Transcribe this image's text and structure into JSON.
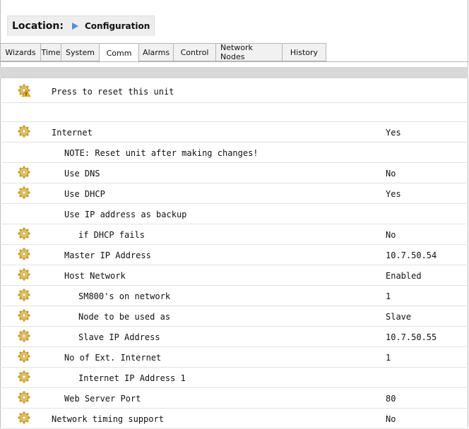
{
  "location": {
    "label": "Location:",
    "value": "Configuration"
  },
  "tabs": [
    {
      "label": "Wizards",
      "active": false
    },
    {
      "label": "Time",
      "active": false
    },
    {
      "label": "System",
      "active": false
    },
    {
      "label": "Comm",
      "active": true
    },
    {
      "label": "Alarms",
      "active": false
    },
    {
      "label": "Control",
      "active": false
    },
    {
      "label": "Network Nodes",
      "active": false
    },
    {
      "label": "History",
      "active": false
    }
  ],
  "rows": [
    {
      "icon": "warning-gear-icon",
      "label": "Press to reset this unit",
      "value": "",
      "indent": 0
    },
    {
      "icon": "",
      "label": "",
      "value": "",
      "indent": 0,
      "blank": true
    },
    {
      "icon": "gear-icon",
      "label": "Internet",
      "value": "Yes",
      "indent": 0
    },
    {
      "icon": "",
      "label": "NOTE: Reset unit after making changes!",
      "value": "",
      "indent": 1
    },
    {
      "icon": "gear-icon",
      "label": "Use DNS",
      "value": "No",
      "indent": 1
    },
    {
      "icon": "gear-icon",
      "label": "Use DHCP",
      "value": "Yes",
      "indent": 1
    },
    {
      "icon": "",
      "label": "Use IP address as backup",
      "value": "",
      "indent": 1
    },
    {
      "icon": "gear-icon",
      "label": "if DHCP fails",
      "value": "No",
      "indent": 2
    },
    {
      "icon": "gear-icon",
      "label": "Master IP Address",
      "value": "10.7.50.54",
      "indent": 1
    },
    {
      "icon": "gear-icon",
      "label": "Host Network",
      "value": "Enabled",
      "indent": 1
    },
    {
      "icon": "gear-icon",
      "label": "SM800's on network",
      "value": "1",
      "indent": 2
    },
    {
      "icon": "gear-icon",
      "label": "Node to be used as",
      "value": "Slave",
      "indent": 2
    },
    {
      "icon": "gear-icon",
      "label": "Slave IP Address",
      "value": "10.7.50.55",
      "indent": 2
    },
    {
      "icon": "gear-icon",
      "label": "No of Ext. Internet",
      "value": "1",
      "indent": 1
    },
    {
      "icon": "gear-icon",
      "label": "Internet IP Address 1",
      "value": "",
      "indent": 2
    },
    {
      "icon": "gear-icon",
      "label": "Web Server Port",
      "value": "80",
      "indent": 1
    },
    {
      "icon": "gear-icon",
      "label": "Network timing support",
      "value": "No",
      "indent": 0
    }
  ],
  "colors": {
    "accent": "#3b82d6",
    "gear": "#d9b24a",
    "warning": "#e8a21c"
  }
}
